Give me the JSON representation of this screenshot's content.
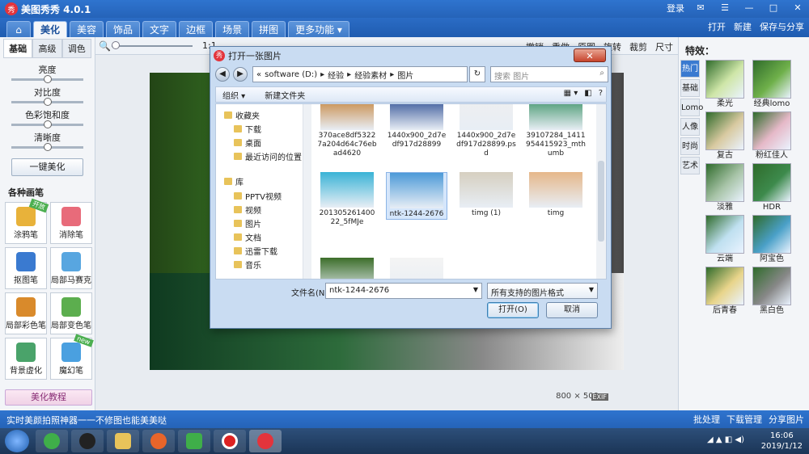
{
  "app": {
    "title": "美图秀秀 4.0.1",
    "logo": "秀",
    "login": "登录"
  },
  "window_controls": [
    "✉",
    "☰",
    "—",
    "□",
    "✕"
  ],
  "nav": {
    "tabs": [
      {
        "label": "⌂"
      },
      {
        "label": "美化"
      },
      {
        "label": "美容"
      },
      {
        "label": "饰品"
      },
      {
        "label": "文字"
      },
      {
        "label": "边框"
      },
      {
        "label": "场景"
      },
      {
        "label": "拼图"
      },
      {
        "label": "更多功能 ▾"
      }
    ],
    "open": "打开",
    "new": "新建",
    "save_share": "保存与分享"
  },
  "toolbar": {
    "zoom_label": "1:1",
    "right": [
      "撤销",
      "重做",
      "原图",
      "旋转",
      "裁剪",
      "尺寸"
    ]
  },
  "left": {
    "tabs": [
      "基础",
      "高级",
      "调色"
    ],
    "sliders": [
      "亮度",
      "对比度",
      "色彩饱和度",
      "清晰度"
    ],
    "one_key": "一键美化",
    "brush_title": "各种画笔",
    "brushes": [
      {
        "label": "涂鸦笔",
        "badge": "开放",
        "color": "#e8b23a"
      },
      {
        "label": "消除笔",
        "badge": "",
        "color": "#e86b7a"
      },
      {
        "label": "抠图笔",
        "badge": "",
        "color": "#3a7ad0"
      },
      {
        "label": "局部马赛克",
        "badge": "",
        "color": "#58a6e0"
      },
      {
        "label": "局部彩色笔",
        "badge": "",
        "color": "#d98a2b"
      },
      {
        "label": "局部变色笔",
        "badge": "",
        "color": "#5cae4e"
      },
      {
        "label": "背景虚化",
        "badge": "",
        "color": "#4aa36a"
      },
      {
        "label": "魔幻笔",
        "badge": "new",
        "color": "#4aa0e0"
      }
    ],
    "tutorial": "美化教程"
  },
  "canvas": {
    "size": "800 × 500",
    "exif": "EXIF"
  },
  "right": {
    "title": "特效：",
    "tabs": [
      "热门",
      "基础",
      "Lomo",
      "人像",
      "时尚",
      "艺术"
    ],
    "effects": [
      "柔光",
      "经典lomo",
      "复古",
      "粉红佳人",
      "淡雅",
      "HDR",
      "云端",
      "阿宝色",
      "后青春",
      "黑白色"
    ]
  },
  "status": {
    "message": "实时美颜拍照神器一一不修图也能美美哒",
    "right": [
      "批处理",
      "下载管理",
      "分享图片"
    ]
  },
  "taskbar": {
    "time": "16:06",
    "date": "2019/1/12",
    "tray": "◢ ▲ ◧ ◀)"
  },
  "dialog": {
    "title": "打开一张图片",
    "path": [
      "«",
      "software (D:)",
      "▸",
      "经验",
      "▸",
      "经验素材",
      "▸",
      "图片"
    ],
    "search_placeholder": "搜索 图片",
    "organize": "组织 ▾",
    "new_folder": "新建文件夹",
    "tree": [
      {
        "label": "收藏夹",
        "child": false
      },
      {
        "label": "下载",
        "child": true
      },
      {
        "label": "桌面",
        "child": true
      },
      {
        "label": "最近访问的位置",
        "child": true
      },
      {
        "label": "库",
        "child": false
      },
      {
        "label": "PPTV视频",
        "child": true
      },
      {
        "label": "视频",
        "child": true
      },
      {
        "label": "图片",
        "child": true
      },
      {
        "label": "文档",
        "child": true
      },
      {
        "label": "迅雷下载",
        "child": true
      },
      {
        "label": "音乐",
        "child": true
      }
    ],
    "files": [
      {
        "name": "370ace8df53227a204d64c76ebad4620",
        "color": "#c27a2a"
      },
      {
        "name": "1440x900_2d7edf917d28899",
        "color": "#1c3f8a"
      },
      {
        "name": "1440x900_2d7edf917d28899.psd",
        "color": "#efefef"
      },
      {
        "name": "39107284_1411954415923_mthumb",
        "color": "#2c8a5a"
      },
      {
        "name": "201305261400 22_5fMJe",
        "color": "#39b3d6"
      },
      {
        "name": "ntk-1244-2676",
        "color": "#4d9ad8"
      },
      {
        "name": "timg (1)",
        "color": "#d6cfc0"
      },
      {
        "name": "timg",
        "color": "#e6b78a"
      },
      {
        "name": "",
        "color": "#3c6e2a"
      },
      {
        "name": "",
        "color": "#f4f4f4"
      }
    ],
    "filename_label": "文件名(N):",
    "filename": "ntk-1244-2676",
    "filetype": "所有支持的图片格式",
    "open_button": "打开(O)",
    "cancel_button": "取消"
  }
}
